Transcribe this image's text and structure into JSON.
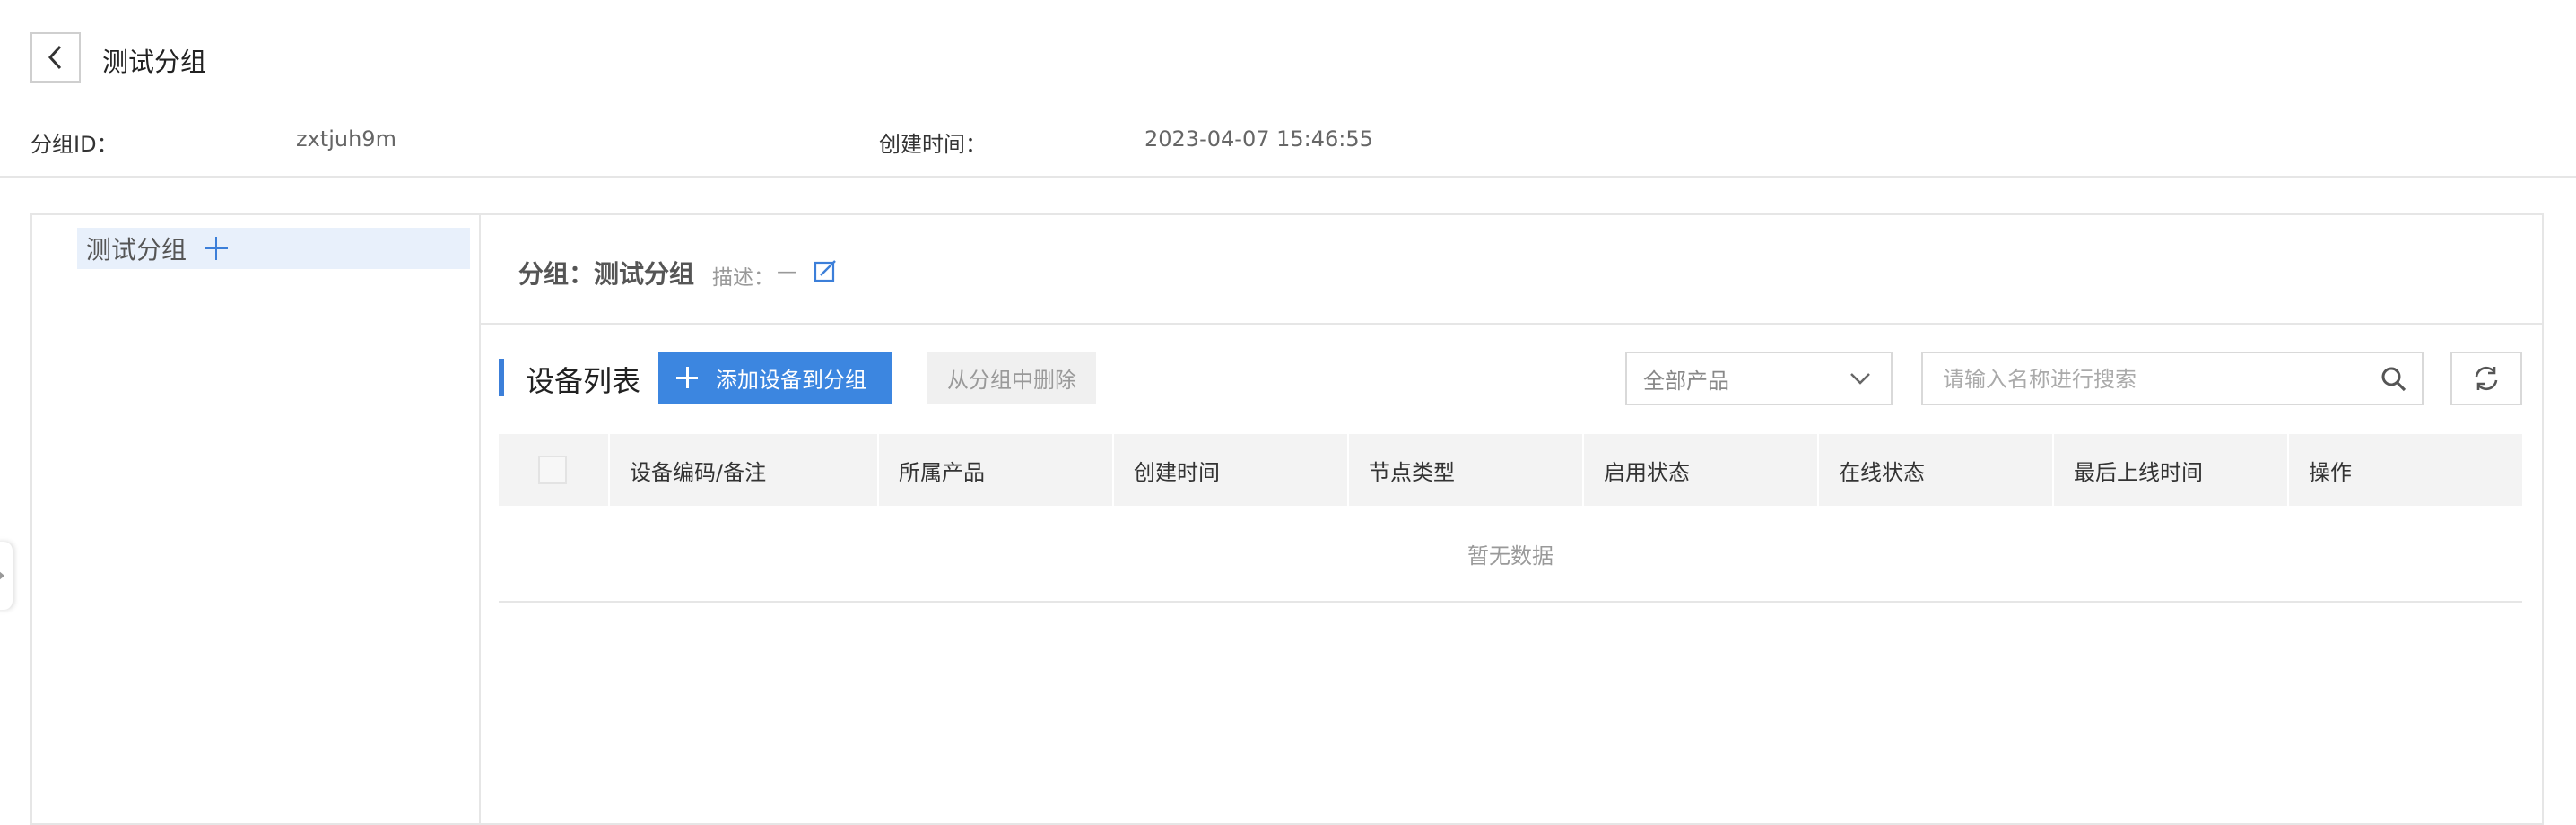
{
  "header": {
    "title": "测试分组",
    "group_id_label": "分组ID：",
    "group_id_value": "zxtjuh9m",
    "created_label": "创建时间：",
    "created_value": "2023-04-07 15:46:55"
  },
  "tree": {
    "node_label": "测试分组"
  },
  "group_info": {
    "group_label": "分组：测试分组",
    "desc_label": "描述：",
    "desc_value": "—"
  },
  "device_list": {
    "title": "设备列表",
    "add_button": "添加设备到分组",
    "remove_button": "从分组中删除",
    "product_select": "全部产品",
    "search_placeholder": "请输入名称进行搜索",
    "columns": [
      "设备编码/备注",
      "所属产品",
      "创建时间",
      "节点类型",
      "启用状态",
      "在线状态",
      "最后上线时间",
      "操作"
    ],
    "empty_text": "暂无数据"
  },
  "colors": {
    "accent": "#3c86e0",
    "tree_selected_bg": "#e8f0fb",
    "table_header_bg": "#f3f3f3"
  }
}
